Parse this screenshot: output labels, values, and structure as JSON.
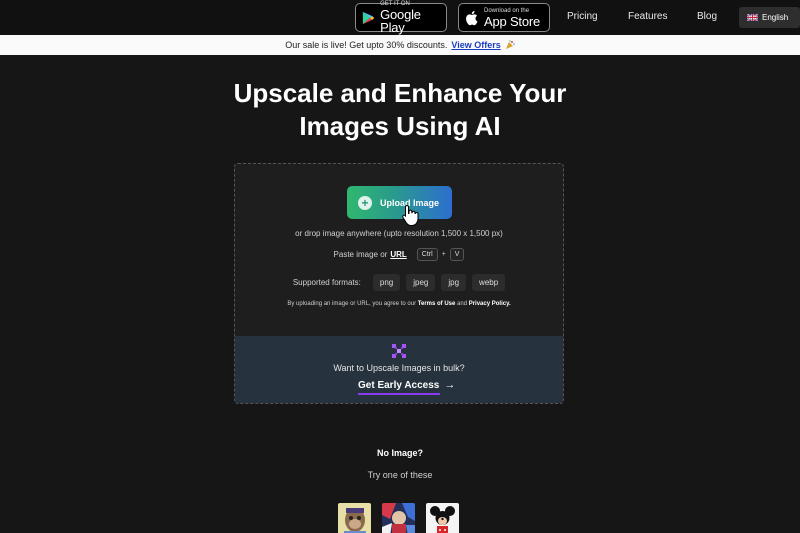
{
  "nav": {
    "google_play_small": "GET IT ON",
    "google_play_big": "Google Play",
    "app_store_small": "Download on the",
    "app_store_big": "App Store",
    "pricing": "Pricing",
    "features": "Features",
    "blog": "Blog",
    "language": "English"
  },
  "banner": {
    "text": "Our sale is live! Get upto 30% discounts.",
    "link": "View Offers"
  },
  "hero": {
    "line1": "Upscale and Enhance Your",
    "line2": "Images Using AI"
  },
  "upload": {
    "button_label": "Upload Image",
    "drop_text": "or drop image anywhere (upto resolution 1,500 x 1,500 px)",
    "paste_prefix": "Paste image or",
    "paste_url": "URL",
    "key_ctrl": "Ctrl",
    "key_plus": "+",
    "key_v": "V",
    "formats_label": "Supported formats:",
    "formats": [
      "png",
      "jpeg",
      "jpg",
      "webp"
    ],
    "terms_prefix": "By uploading an image or URL, you agree to our",
    "terms_link": "Terms of Use",
    "terms_and": "and",
    "privacy_link": "Privacy Policy."
  },
  "bulk": {
    "text": "Want to Upscale Images in bulk?",
    "cta": "Get Early Access",
    "cta_arrow": "→"
  },
  "samples": {
    "heading": "No Image?",
    "subheading": "Try one of these"
  },
  "colors": {
    "background": "#161616",
    "card": "#1e1e1e",
    "bulk_panel": "#26323d",
    "accent_purple": "#8b3cf0",
    "offer_link": "#1a3dbf"
  }
}
